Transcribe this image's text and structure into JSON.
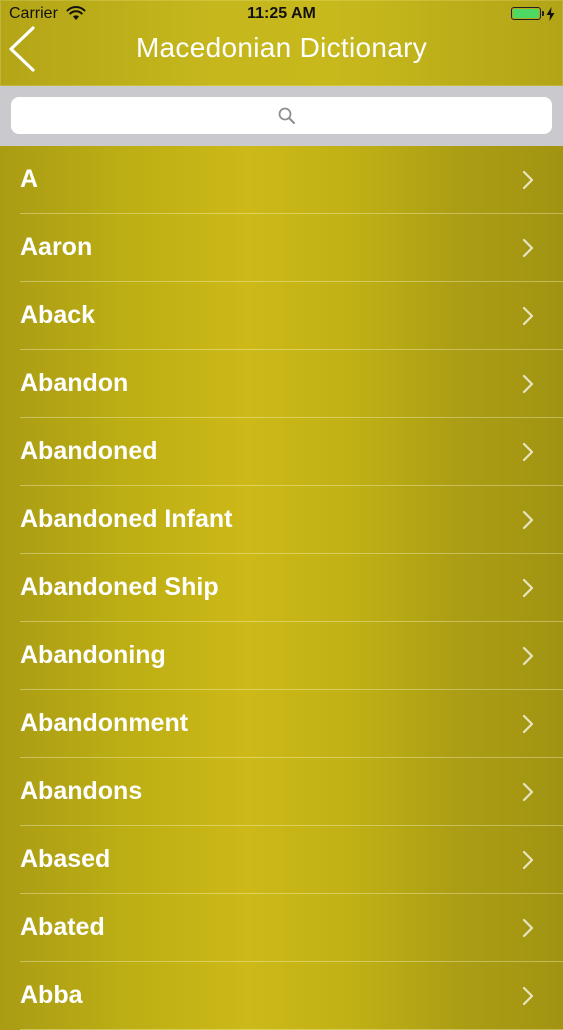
{
  "status_bar": {
    "carrier": "Carrier",
    "time": "11:25 AM",
    "battery_color": "#4cd964"
  },
  "nav": {
    "title": "Macedonian Dictionary",
    "back_icon": "chevron-left-icon"
  },
  "search": {
    "placeholder": "",
    "icon": "magnifier-icon"
  },
  "list": {
    "items": [
      {
        "label": "A"
      },
      {
        "label": "Aaron"
      },
      {
        "label": "Aback"
      },
      {
        "label": "Abandon"
      },
      {
        "label": "Abandoned"
      },
      {
        "label": "Abandoned Infant"
      },
      {
        "label": "Abandoned Ship"
      },
      {
        "label": "Abandoning"
      },
      {
        "label": "Abandonment"
      },
      {
        "label": "Abandons"
      },
      {
        "label": "Abased"
      },
      {
        "label": "Abated"
      },
      {
        "label": "Abba"
      }
    ]
  },
  "colors": {
    "nav_bar": "#c1b31a",
    "list_background": "#bcae14",
    "search_bar": "#c9c9ce"
  }
}
